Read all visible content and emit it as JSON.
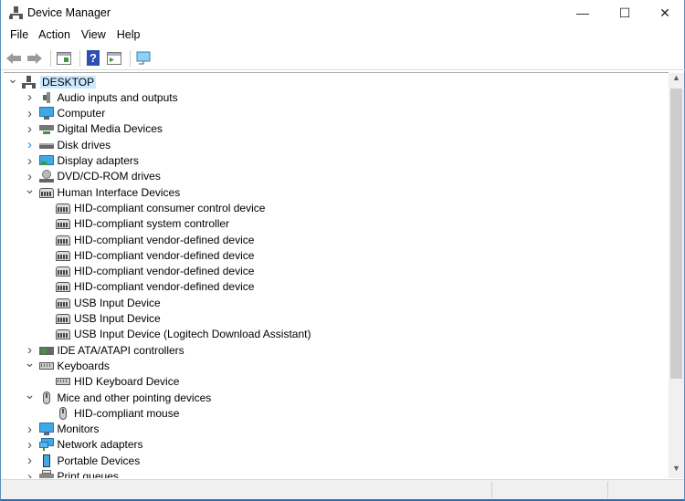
{
  "window": {
    "title": "Device Manager",
    "minimize": "—",
    "maximize": "☐",
    "close": "✕"
  },
  "menu": [
    "File",
    "Action",
    "View",
    "Help"
  ],
  "toolbar": {
    "icons": [
      "back-icon",
      "forward-icon",
      "show-hide-console-tree-icon",
      "help-icon",
      "action-pane-icon",
      "scan-hardware-icon"
    ],
    "help_glyph": "?"
  },
  "tree": [
    {
      "label": "DESKTOP",
      "level": 0,
      "state": "expanded",
      "icon": "computer-network-icon",
      "selected": true
    },
    {
      "label": "Audio inputs and outputs",
      "level": 1,
      "state": "collapsed",
      "icon": "speaker-icon"
    },
    {
      "label": "Computer",
      "level": 1,
      "state": "collapsed",
      "icon": "monitor-icon"
    },
    {
      "label": "Digital Media Devices",
      "level": 1,
      "state": "collapsed",
      "icon": "media-device-icon"
    },
    {
      "label": "Disk drives",
      "level": 1,
      "state": "collapsed-hover",
      "icon": "disk-drive-icon"
    },
    {
      "label": "Display adapters",
      "level": 1,
      "state": "collapsed",
      "icon": "display-adapter-icon"
    },
    {
      "label": "DVD/CD-ROM drives",
      "level": 1,
      "state": "collapsed",
      "icon": "dvd-icon"
    },
    {
      "label": "Human Interface Devices",
      "level": 1,
      "state": "expanded",
      "icon": "hid-icon"
    },
    {
      "label": "HID-compliant consumer control device",
      "level": 2,
      "icon": "hid-icon"
    },
    {
      "label": "HID-compliant system controller",
      "level": 2,
      "icon": "hid-icon"
    },
    {
      "label": "HID-compliant vendor-defined device",
      "level": 2,
      "icon": "hid-icon"
    },
    {
      "label": "HID-compliant vendor-defined device",
      "level": 2,
      "icon": "hid-icon"
    },
    {
      "label": "HID-compliant vendor-defined device",
      "level": 2,
      "icon": "hid-icon"
    },
    {
      "label": "HID-compliant vendor-defined device",
      "level": 2,
      "icon": "hid-icon"
    },
    {
      "label": "USB Input Device",
      "level": 2,
      "icon": "hid-icon"
    },
    {
      "label": "USB Input Device",
      "level": 2,
      "icon": "hid-icon"
    },
    {
      "label": "USB Input Device (Logitech Download Assistant)",
      "level": 2,
      "icon": "hid-icon"
    },
    {
      "label": "IDE ATA/ATAPI controllers",
      "level": 1,
      "state": "collapsed",
      "icon": "ide-controller-icon"
    },
    {
      "label": "Keyboards",
      "level": 1,
      "state": "expanded",
      "icon": "keyboard-icon"
    },
    {
      "label": "HID Keyboard Device",
      "level": 2,
      "icon": "keyboard-icon"
    },
    {
      "label": "Mice and other pointing devices",
      "level": 1,
      "state": "expanded",
      "icon": "mouse-icon"
    },
    {
      "label": "HID-compliant mouse",
      "level": 2,
      "icon": "mouse-icon"
    },
    {
      "label": "Monitors",
      "level": 1,
      "state": "collapsed",
      "icon": "monitor-icon"
    },
    {
      "label": "Network adapters",
      "level": 1,
      "state": "collapsed",
      "icon": "network-adapter-icon"
    },
    {
      "label": "Portable Devices",
      "level": 1,
      "state": "collapsed",
      "icon": "portable-device-icon"
    },
    {
      "label": "Print queues",
      "level": 1,
      "state": "collapsed",
      "icon": "printer-icon"
    }
  ],
  "colors": {
    "selection": "#cce8ff",
    "accent": "#2b6fb4",
    "hover_chevron": "#1e90ff"
  }
}
